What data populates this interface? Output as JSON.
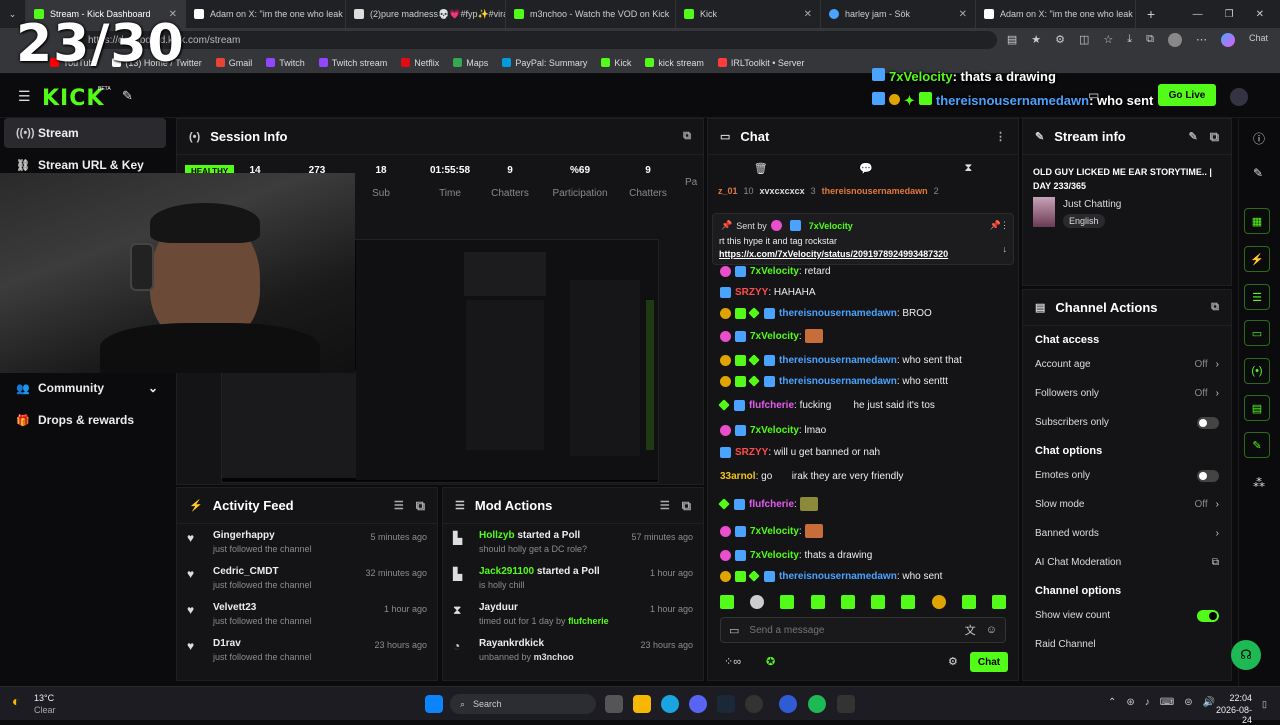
{
  "overlay": {
    "counter": "23/30",
    "line1_user": "7xVelocity",
    "line1_msg": ": thats a drawing",
    "line2_user": "thereisnousernamedawn",
    "line2_msg": ": who sent"
  },
  "tabs": [
    {
      "label": "Stream - Kick Dashboard",
      "color": "#53fc18",
      "active": true
    },
    {
      "label": "Adam on X: \"im the one who leak",
      "color": "#ffffff"
    },
    {
      "label": "(2)pure madness💀💗#fyp✨#viral",
      "color": "#ffffff"
    },
    {
      "label": "m3nchoo - Watch the VOD on Kick",
      "color": "#53fc18"
    },
    {
      "label": "Kick",
      "color": "#53fc18"
    },
    {
      "label": "harley jam - Sök",
      "color": "#4aa3ff"
    },
    {
      "label": "Adam on X: \"im the one who leak",
      "color": "#ffffff"
    }
  ],
  "url": "https://dashboard.kick.com/stream",
  "bookmarks": [
    "YouTube",
    "(13) Home / Twitter",
    "Gmail",
    "Twitch",
    "Twitch stream",
    "Netflix",
    "Maps",
    "PayPal: Summary",
    "Kick",
    "kick stream",
    "IRLToolkit • Server"
  ],
  "kick": {
    "logo": "KICK",
    "beta": "BETA",
    "go_live": "Go Live"
  },
  "sidebar": {
    "items": [
      {
        "label": "Stream",
        "icon": "broadcast-icon"
      },
      {
        "label": "Stream URL & Key",
        "icon": "link-icon"
      },
      {
        "label": "Community",
        "icon": "people-icon"
      },
      {
        "label": "Drops & rewards",
        "icon": "gift-icon"
      }
    ]
  },
  "session": {
    "title": "Session Info",
    "health": "HEALTHY",
    "stats": [
      {
        "value": "14",
        "label": ""
      },
      {
        "value": "273",
        "label": ""
      },
      {
        "value": "18",
        "label": "Sub"
      },
      {
        "value": "01:55:58",
        "label": "Time"
      },
      {
        "value": "9",
        "label": "Chatters"
      },
      {
        "value": "%69",
        "label": "Participation"
      },
      {
        "value": "9",
        "label": "Chatters"
      },
      {
        "value": "",
        "label": "Pa"
      }
    ]
  },
  "activity": {
    "title": "Activity Feed",
    "items": [
      {
        "name": "Gingerhappy",
        "desc": "just followed the channel",
        "time": "5 minutes ago"
      },
      {
        "name": "Cedric_CMDT",
        "desc": "just followed the channel",
        "time": "32 minutes ago"
      },
      {
        "name": "Velvett23",
        "desc": "just followed the channel",
        "time": "1 hour ago"
      },
      {
        "name": "D1rav",
        "desc": "just followed the channel",
        "time": "23 hours ago"
      }
    ]
  },
  "mod": {
    "title": "Mod Actions",
    "items": [
      {
        "user": "Hollzyb",
        "action": "started a Poll",
        "desc": "should holly get a DC role?",
        "time": "57 minutes ago"
      },
      {
        "user": "Jack291100",
        "action": "started a Poll",
        "desc": "is holly chill",
        "time": "1 hour ago"
      },
      {
        "user": "Jayduur",
        "action": "",
        "desc": "timed out for 1 day by",
        "by": "flufcherie",
        "time": "1 hour ago"
      },
      {
        "user": "Rayankrdkick",
        "action": "",
        "desc": "unbanned by",
        "by": "m3nchoo",
        "time": "23 hours ago"
      }
    ]
  },
  "chat": {
    "title": "Chat",
    "top_users": [
      "z_01",
      "10",
      "xvxcxcxcx",
      "3",
      "thereisnousernamedawn",
      "2"
    ],
    "pinned": {
      "sent_by_label": "Sent by",
      "user": "7xVelocity",
      "text": "rt this hype it and tag rockstar",
      "link": "https://x.com/7xVelocity/status/2091978924993487320"
    },
    "messages": [
      {
        "user": "7xVelocity",
        "cls": "u-vel",
        "text": ": retard"
      },
      {
        "user": "SRZYY",
        "cls": "u-srz",
        "text": ": HAHAHA"
      },
      {
        "user": "thereisnousernamedawn",
        "cls": "u-dawn",
        "text": ": BROO"
      },
      {
        "user": "7xVelocity",
        "cls": "u-vel",
        "text": ":"
      },
      {
        "user": "thereisnousernamedawn",
        "cls": "u-dawn",
        "text": ": who sent that"
      },
      {
        "user": "thereisnousernamedawn",
        "cls": "u-dawn",
        "text": ": who senttt"
      },
      {
        "user": "flufcherie",
        "cls": "u-flu",
        "text": ": fucking        he just said it's tos"
      },
      {
        "user": "7xVelocity",
        "cls": "u-vel",
        "text": ": lmao"
      },
      {
        "user": "SRZYY",
        "cls": "u-srz",
        "text": ": will u get banned or nah"
      },
      {
        "user": "33arnol",
        "cls": "u-33",
        "text": ": go       irak they are very friendly"
      },
      {
        "user": "flufcherie",
        "cls": "u-flu",
        "text": ":"
      },
      {
        "user": "7xVelocity",
        "cls": "u-vel",
        "text": ":"
      },
      {
        "user": "7xVelocity",
        "cls": "u-vel",
        "text": ": thats a drawing"
      },
      {
        "user": "thereisnousernamedawn",
        "cls": "u-dawn",
        "text": ": who sent"
      }
    ],
    "placeholder": "Send a message",
    "send": "Chat"
  },
  "stream_info": {
    "title": "Stream info",
    "stream_title": "OLD GUY LICKED ME EAR STORYTIME.. | DAY 233/365",
    "category": "Just Chatting",
    "language": "English"
  },
  "channel_actions": {
    "title": "Channel Actions",
    "chat_access": "Chat access",
    "account_age": "Account age",
    "account_age_val": "Off",
    "followers_only": "Followers only",
    "followers_only_val": "Off",
    "subscribers_only": "Subscribers only",
    "chat_options": "Chat options",
    "emotes_only": "Emotes only",
    "slow_mode": "Slow mode",
    "slow_mode_val": "Off",
    "banned_words": "Banned words",
    "ai_mod": "AI Chat Moderation",
    "channel_options": "Channel options",
    "show_view_count": "Show view count",
    "raid_channel": "Raid Channel"
  },
  "taskbar": {
    "weather_temp": "13°C",
    "weather_desc": "Clear",
    "search": "Search",
    "time": "22:04",
    "date": "2026-08-24"
  }
}
